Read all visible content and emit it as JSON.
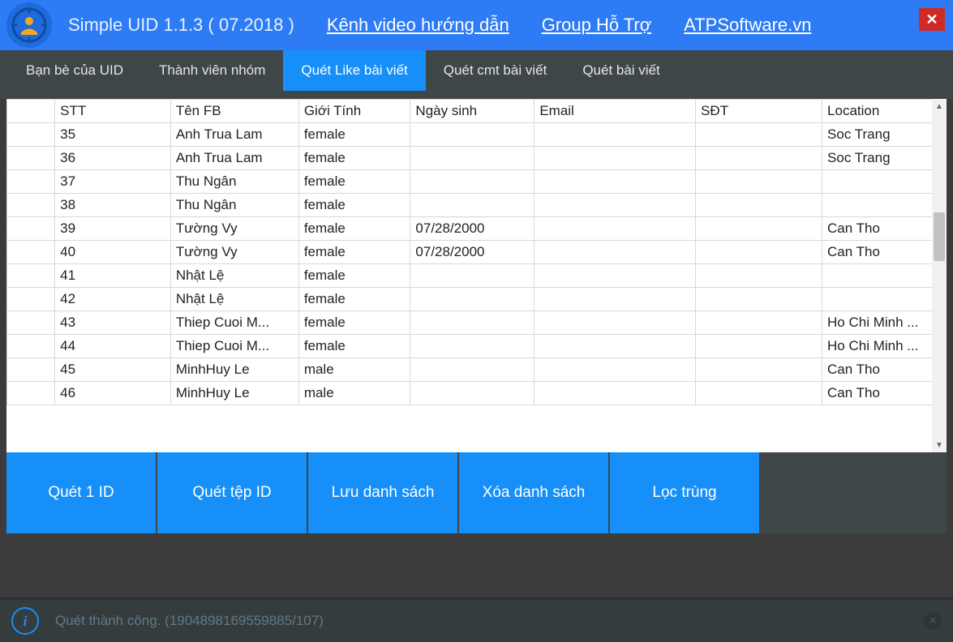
{
  "titlebar": {
    "app_title": "Simple UID 1.1.3 ( 07.2018 )",
    "links": {
      "video": "Kênh video hướng dẫn",
      "group": "Group Hỗ Trợ",
      "site": "ATPSoftware.vn"
    },
    "close": "✕"
  },
  "tabs": [
    {
      "label": "Bạn bè của UID",
      "active": false
    },
    {
      "label": "Thành viên nhóm",
      "active": false
    },
    {
      "label": "Quét Like bài viết",
      "active": true
    },
    {
      "label": "Quét cmt bài viết",
      "active": false
    },
    {
      "label": "Quét bài viết",
      "active": false
    }
  ],
  "table": {
    "headers": {
      "stt": "STT",
      "name": "Tên FB",
      "gender": "Giới Tính",
      "dob": "Ngày sinh",
      "email": "Email",
      "phone": "SĐT",
      "location": "Location"
    },
    "rows": [
      {
        "stt": "35",
        "name": "Anh Trua Lam",
        "gender": "female",
        "dob": "",
        "email": "",
        "phone": "",
        "location": "Soc Trang"
      },
      {
        "stt": "36",
        "name": "Anh Trua Lam",
        "gender": "female",
        "dob": "",
        "email": "",
        "phone": "",
        "location": "Soc Trang"
      },
      {
        "stt": "37",
        "name": "Thu Ngân",
        "gender": "female",
        "dob": "",
        "email": "",
        "phone": "",
        "location": ""
      },
      {
        "stt": "38",
        "name": "Thu Ngân",
        "gender": "female",
        "dob": "",
        "email": "",
        "phone": "",
        "location": ""
      },
      {
        "stt": "39",
        "name": "Tường Vy",
        "gender": "female",
        "dob": "07/28/2000",
        "email": "",
        "phone": "",
        "location": "Can Tho"
      },
      {
        "stt": "40",
        "name": "Tường Vy",
        "gender": "female",
        "dob": "07/28/2000",
        "email": "",
        "phone": "",
        "location": "Can Tho"
      },
      {
        "stt": "41",
        "name": "Nhật Lệ",
        "gender": "female",
        "dob": "",
        "email": "",
        "phone": "",
        "location": ""
      },
      {
        "stt": "42",
        "name": "Nhật Lệ",
        "gender": "female",
        "dob": "",
        "email": "",
        "phone": "",
        "location": ""
      },
      {
        "stt": "43",
        "name": "Thiep Cuoi M...",
        "gender": "female",
        "dob": "",
        "email": "",
        "phone": "",
        "location": "Ho Chi Minh ..."
      },
      {
        "stt": "44",
        "name": "Thiep Cuoi M...",
        "gender": "female",
        "dob": "",
        "email": "",
        "phone": "",
        "location": "Ho Chi Minh ..."
      },
      {
        "stt": "45",
        "name": "MinhHuy Le",
        "gender": "male",
        "dob": "",
        "email": "",
        "phone": "",
        "location": "Can Tho"
      },
      {
        "stt": "46",
        "name": "MinhHuy Le",
        "gender": "male",
        "dob": "",
        "email": "",
        "phone": "",
        "location": "Can Tho"
      }
    ]
  },
  "actions": {
    "scan_one": "Quét 1 ID",
    "scan_file": "Quét tệp ID",
    "save_list": "Lưu danh sách",
    "clear_list": "Xóa danh sách",
    "dedupe": "Lọc trùng"
  },
  "status": {
    "text": "Quét thành công. (1904898169559885/107)"
  }
}
